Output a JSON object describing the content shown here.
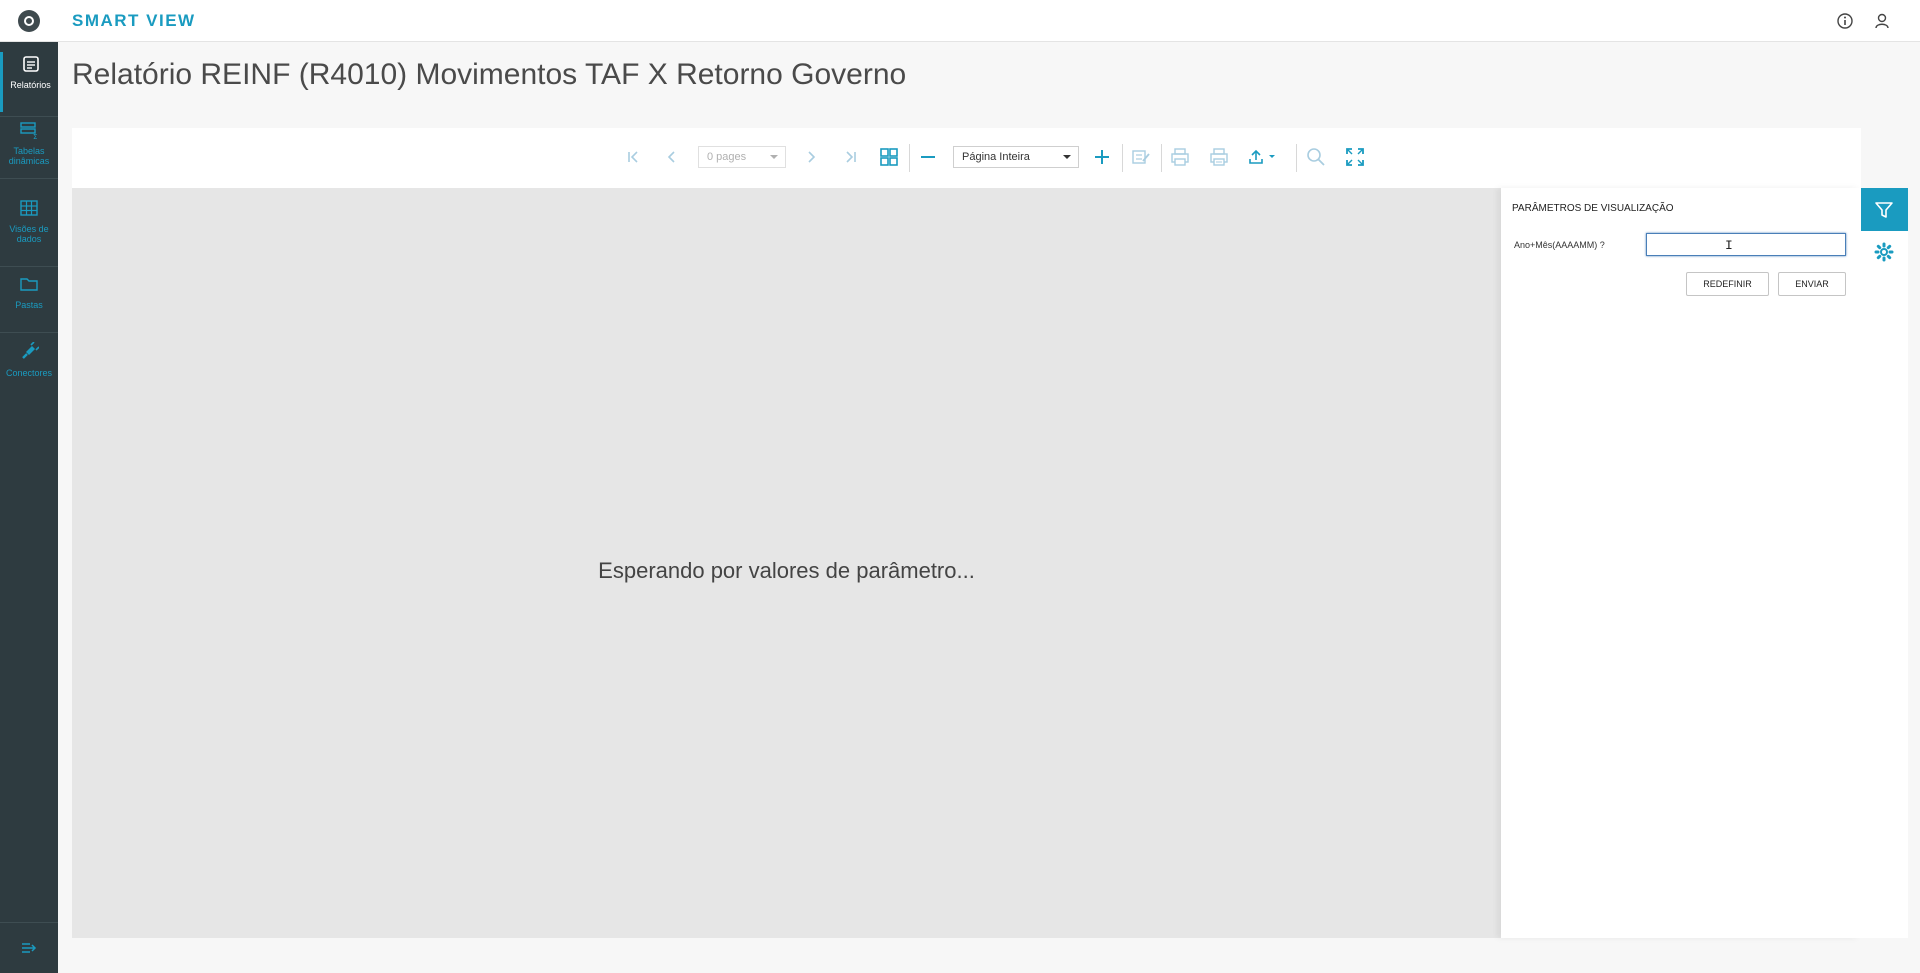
{
  "header": {
    "brand": "SMART VIEW",
    "icons": [
      "logo-icon",
      "info-icon",
      "user-icon"
    ]
  },
  "sidebar": {
    "items": [
      {
        "label": "Relatórios",
        "icon": "report-icon",
        "active": true
      },
      {
        "label": "Tabelas dinâmicas",
        "icon": "pivot-table-icon",
        "active": false
      },
      {
        "label": "Visões de dados",
        "icon": "grid-icon",
        "active": false
      },
      {
        "label": "Pastas",
        "icon": "folder-icon",
        "active": false
      },
      {
        "label": "Conectores",
        "icon": "plug-icon",
        "active": false
      }
    ],
    "collapse_icon": "collapse-icon"
  },
  "page": {
    "title": "Relatório REINF (R4010) Movimentos TAF X Retorno Governo"
  },
  "toolbar": {
    "pages_value": "0 pages",
    "zoom_value": "Página Inteira"
  },
  "viewer": {
    "status_text": "Esperando por valores de parâmetro..."
  },
  "params": {
    "title": "PARÂMETROS DE VISUALIZAÇÃO",
    "field_label": "Ano+Mês(AAAAMM) ?",
    "field_value": "",
    "reset_label": "REDEFINIR",
    "send_label": "ENVIAR"
  },
  "colors": {
    "accent": "#1a9bc0",
    "sidebar_bg": "#2e3b40",
    "viewer_bg": "#e6e6e6"
  }
}
